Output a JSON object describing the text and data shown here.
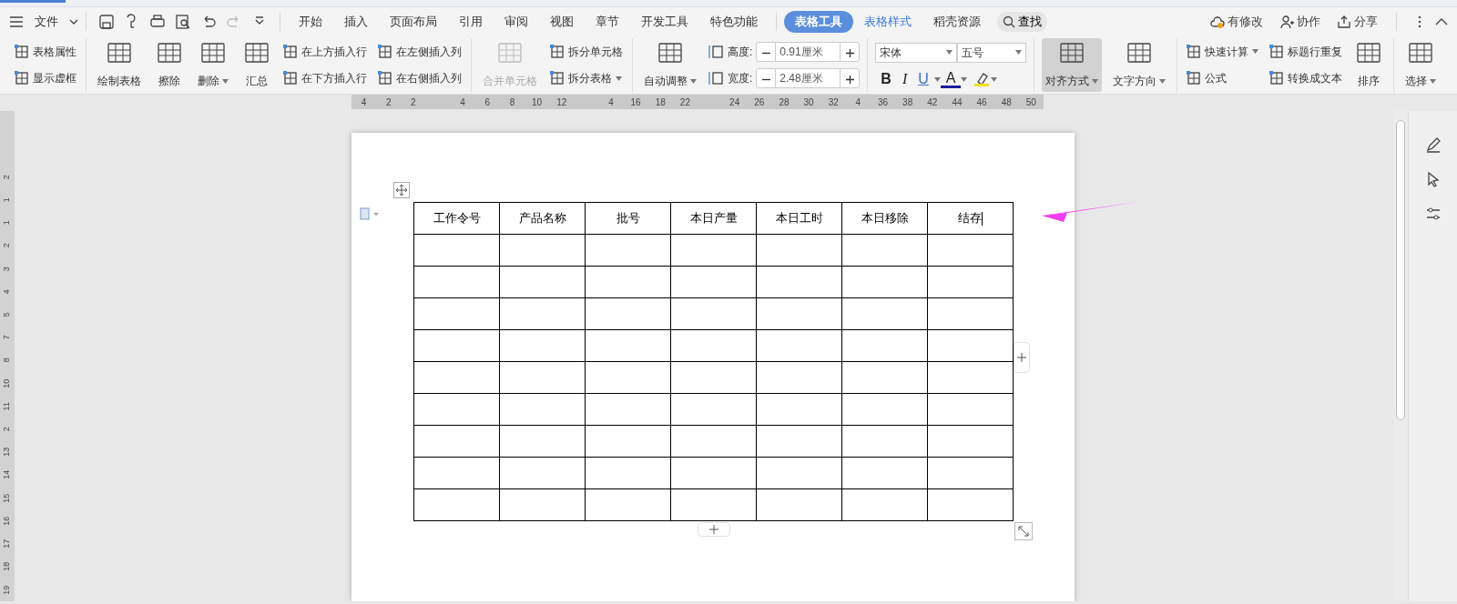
{
  "menu": {
    "file": "文件",
    "tabs": [
      {
        "label": "开始",
        "selected": false,
        "kind": "normal"
      },
      {
        "label": "插入",
        "selected": false,
        "kind": "normal"
      },
      {
        "label": "页面布局",
        "selected": false,
        "kind": "normal"
      },
      {
        "label": "引用",
        "selected": false,
        "kind": "normal"
      },
      {
        "label": "审阅",
        "selected": false,
        "kind": "normal"
      },
      {
        "label": "视图",
        "selected": false,
        "kind": "normal"
      },
      {
        "label": "章节",
        "selected": false,
        "kind": "normal"
      },
      {
        "label": "开发工具",
        "selected": false,
        "kind": "normal"
      },
      {
        "label": "特色功能",
        "selected": false,
        "kind": "normal"
      },
      {
        "label": "表格工具",
        "selected": true,
        "kind": "context"
      },
      {
        "label": "表格样式",
        "selected": false,
        "kind": "context"
      },
      {
        "label": "稻壳资源",
        "selected": false,
        "kind": "normal"
      }
    ],
    "search": "查找",
    "status": "有修改",
    "collaborate": "协作",
    "share": "分享"
  },
  "ribbon": [
    {
      "columns": [
        {
          "kind": "stack",
          "items": [
            {
              "label": "表格属性",
              "dropdown": false,
              "disabled": false
            },
            {
              "label": "显示虚框",
              "dropdown": false,
              "disabled": false
            }
          ]
        }
      ]
    },
    {
      "columns": [
        {
          "kind": "large",
          "label": "绘制表格",
          "dropdown": false,
          "disabled": false
        },
        {
          "kind": "large",
          "label": "擦除",
          "dropdown": false,
          "disabled": false
        },
        {
          "kind": "large",
          "label": "删除",
          "dropdown": true,
          "disabled": false
        },
        {
          "kind": "large",
          "label": "汇总",
          "dropdown": false,
          "disabled": false
        },
        {
          "kind": "stack",
          "items": [
            {
              "label": "在上方插入行",
              "dropdown": false,
              "disabled": false
            },
            {
              "label": "在下方插入行",
              "dropdown": false,
              "disabled": false
            }
          ]
        },
        {
          "kind": "stack",
          "items": [
            {
              "label": "在左侧插入列",
              "dropdown": false,
              "disabled": false
            },
            {
              "label": "在右侧插入列",
              "dropdown": false,
              "disabled": false
            }
          ]
        }
      ]
    },
    {
      "columns": [
        {
          "kind": "large",
          "label": "合并单元格",
          "dropdown": false,
          "disabled": true
        },
        {
          "kind": "stack",
          "items": [
            {
              "label": "拆分单元格",
              "dropdown": false,
              "disabled": false
            },
            {
              "label": "拆分表格",
              "dropdown": true,
              "disabled": false
            }
          ]
        }
      ]
    },
    {
      "columns": [
        {
          "kind": "large",
          "label": "自动调整",
          "dropdown": true,
          "disabled": false
        },
        {
          "kind": "sizes",
          "items": [
            {
              "label": "高度:",
              "value": "0.91厘米"
            },
            {
              "label": "宽度:",
              "value": "2.48厘米"
            }
          ]
        }
      ]
    },
    {
      "columns": [
        {
          "kind": "font",
          "font": "宋体",
          "size": "五号",
          "bold": "B",
          "italic": "I",
          "underline": "U",
          "color_letter": "A"
        }
      ]
    },
    {
      "columns": [
        {
          "kind": "large",
          "label": "对齐方式",
          "dropdown": true,
          "disabled": false,
          "selected": true
        },
        {
          "kind": "large",
          "label": "文字方向",
          "dropdown": true,
          "disabled": false,
          "selected": false
        }
      ]
    },
    {
      "columns": [
        {
          "kind": "stack",
          "items": [
            {
              "label": "快速计算",
              "dropdown": true,
              "disabled": false
            },
            {
              "label": "公式",
              "dropdown": false,
              "disabled": false
            }
          ]
        },
        {
          "kind": "stack",
          "items": [
            {
              "label": "标题行重复",
              "dropdown": false,
              "disabled": false
            },
            {
              "label": "转换成文本",
              "dropdown": false,
              "disabled": false
            }
          ]
        },
        {
          "kind": "large",
          "label": "排序",
          "dropdown": false,
          "disabled": false
        }
      ]
    },
    {
      "columns": [
        {
          "kind": "large",
          "label": "选择",
          "dropdown": true,
          "disabled": false
        }
      ]
    }
  ],
  "ruler": {
    "horizontal": [
      "4",
      "2",
      "2",
      "4",
      "6",
      "8",
      "10",
      "12",
      "4",
      "16",
      "18",
      "22",
      "24",
      "26",
      "28",
      "30",
      "32",
      "4",
      "36",
      "38",
      "42",
      "44",
      "46",
      "48",
      "50"
    ],
    "vertical": [
      "2",
      "1",
      "1",
      "2",
      "3",
      "4",
      "5",
      "7",
      "8",
      "10",
      "11",
      "2",
      "13",
      "14",
      "15",
      "16",
      "17",
      "18",
      "19"
    ]
  },
  "table": {
    "columns": [
      {
        "label": "工作令号",
        "cursor": false
      },
      {
        "label": "产品名称",
        "cursor": false
      },
      {
        "label": "批号",
        "cursor": false
      },
      {
        "label": "本日产量",
        "cursor": false
      },
      {
        "label": "本日工时",
        "cursor": false
      },
      {
        "label": "本日移除",
        "cursor": false
      },
      {
        "label": "结存",
        "cursor": true
      }
    ],
    "rows": [
      {
        "kind": "empty"
      },
      {
        "kind": "empty"
      },
      {
        "kind": "empty"
      },
      {
        "kind": "empty"
      },
      {
        "kind": "empty"
      },
      {
        "kind": "empty"
      },
      {
        "kind": "empty"
      },
      {
        "kind": "empty"
      },
      {
        "kind": "empty"
      }
    ]
  }
}
